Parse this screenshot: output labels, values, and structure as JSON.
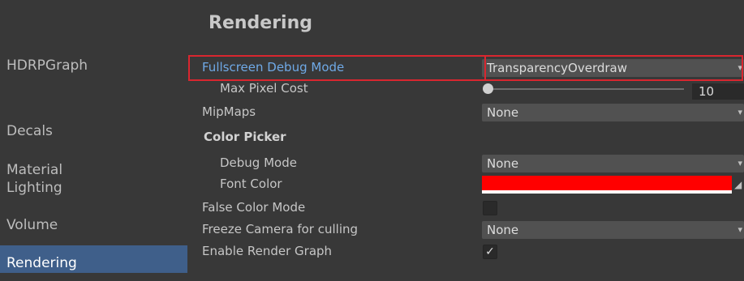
{
  "sidebar": {
    "items": [
      {
        "label": "HDRPGraph",
        "active": false
      },
      {
        "label": "Decals",
        "active": false
      },
      {
        "label": "Material",
        "active": false
      },
      {
        "label": "Lighting",
        "active": false
      },
      {
        "label": "Volume",
        "active": false
      },
      {
        "label": "Rendering",
        "active": true
      }
    ]
  },
  "main": {
    "title": "Rendering",
    "fullscreen_debug_mode": {
      "label": "Fullscreen Debug Mode",
      "value": "TransparencyOverdraw"
    },
    "max_pixel_cost": {
      "label": "Max Pixel Cost",
      "value": "10",
      "fraction": 0.0
    },
    "mipmaps": {
      "label": "MipMaps",
      "value": "None"
    },
    "color_picker": {
      "header": "Color Picker",
      "debug_mode": {
        "label": "Debug Mode",
        "value": "None"
      },
      "font_color": {
        "label": "Font Color",
        "color": "#ff0000"
      }
    },
    "false_color_mode": {
      "label": "False Color Mode",
      "checked": false
    },
    "freeze_camera": {
      "label": "Freeze Camera for culling",
      "value": "None"
    },
    "enable_render_graph": {
      "label": "Enable Render Graph",
      "checked": true
    }
  },
  "colors": {
    "background": "#383838",
    "selection": "#3f5f8a",
    "highlight": "#d9262f",
    "link": "#6fa9e6"
  },
  "icons": {
    "dropdown": "chevron-down-icon",
    "checkmark": "checkmark-icon"
  }
}
